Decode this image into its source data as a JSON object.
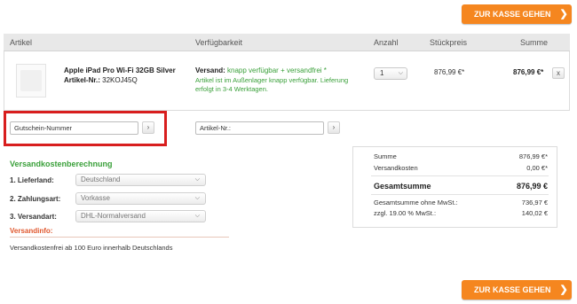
{
  "checkout_top": {
    "label": "ZUR KASSE GEHEN",
    "icon": "chevron-right-icon"
  },
  "checkout_bottom": {
    "label": "ZUR KASSE GEHEN",
    "icon": "chevron-right-icon"
  },
  "table_header": {
    "article": "Artikel",
    "availability": "Verfügbarkeit",
    "quantity": "Anzahl",
    "unit_price": "Stückpreis",
    "sum": "Summe"
  },
  "item": {
    "name": "Apple iPad Pro Wi-Fi 32GB Silver",
    "sku_label": "Artikel-Nr.:",
    "sku": "32KOJ45Q",
    "shipping_label": "Versand:",
    "shipping_status": "knapp verfügbar + versandfrei *",
    "availability_note_1": "Artikel ist im Außenlager knapp verfügbar. Lieferung",
    "availability_note_2": "erfolgt in 3-4 Werktagen.",
    "quantity": "1",
    "unit_price": "876,99 €*",
    "sum": "876,99 €*",
    "remove_label": "x"
  },
  "coupon": {
    "value": "Gutschein-Nummer",
    "submit": "›"
  },
  "sku_add": {
    "value": "Artikel-Nr.:",
    "submit": "›"
  },
  "shipping_calc": {
    "title": "Versandkostenberechnung",
    "country_label": "1. Lieferland:",
    "country_value": "Deutschland",
    "payment_label": "2. Zahlungsart:",
    "payment_value": "Vorkasse",
    "method_label": "3. Versandart:",
    "method_value": "DHL-Normalversand",
    "info_title": "Versandinfo:",
    "info_text": "Versandkostenfrei ab 100 Euro innerhalb Deutschlands"
  },
  "summary": {
    "sum_label": "Summe",
    "sum_value": "876,99 €*",
    "shipping_label": "Versandkosten",
    "shipping_value": "0,00 €*",
    "total_label": "Gesamtsumme",
    "total_value": "876,99 €",
    "net_label": "Gesamtsumme ohne MwSt.:",
    "net_value": "736,97 €",
    "vat_label": "zzgl. 19.00 % MwSt.:",
    "vat_value": "140,02 €"
  },
  "colors": {
    "accent": "#f5861f",
    "green": "#3aa03a",
    "highlight": "#d81e1e"
  }
}
